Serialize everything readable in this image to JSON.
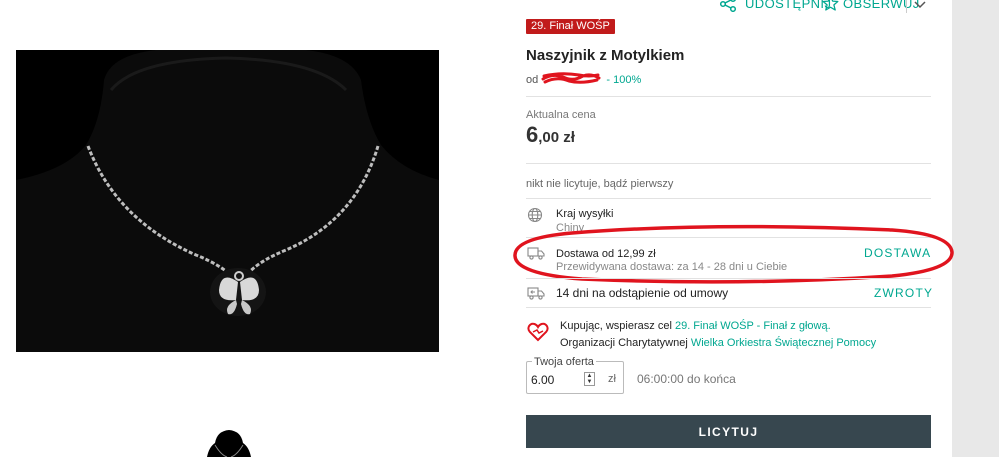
{
  "top_actions": {
    "share_label": "UDOSTĘPNIJ",
    "watch_label": "OBSERWUJ"
  },
  "listing": {
    "badge": "29. Finał WOŚP",
    "title": "Naszyjnik z Motylkiem",
    "seller_prefix": "od",
    "seller_rating": "- 100%"
  },
  "price": {
    "label": "Aktualna cena",
    "integer": "6",
    "decimal": ",00 zł"
  },
  "bid_status": "nikt nie licytuje, bądź pierwszy",
  "shipping": {
    "country_label": "Kraj wysyłki",
    "country_value": "Chiny",
    "delivery_label": "Dostawa od 12,99 zł",
    "delivery_estimate": "Przewidywana dostawa: za 14 - 28 dni u Ciebie",
    "delivery_link": "DOSTAWA",
    "returns_text": "14 dni na odstąpienie od umowy",
    "returns_link": "ZWROTY"
  },
  "charity": {
    "line1_text": "Kupując, wspierasz cel ",
    "line1_link": "29. Finał WOŚP - Finał z głową.",
    "line2_text": "Organizacji Charytatywnej ",
    "line2_link": "Wielka Orkiestra Świątecznej Pomocy"
  },
  "offer": {
    "label": "Twoja oferta",
    "value": "6.00",
    "currency": "zł",
    "countdown": "06:00:00 do końca"
  },
  "bid_button": "LICYTUJ",
  "colors": {
    "accent": "#00a790",
    "badge": "#c11b1b",
    "button": "#37474f",
    "annotation": "#e0141e"
  }
}
